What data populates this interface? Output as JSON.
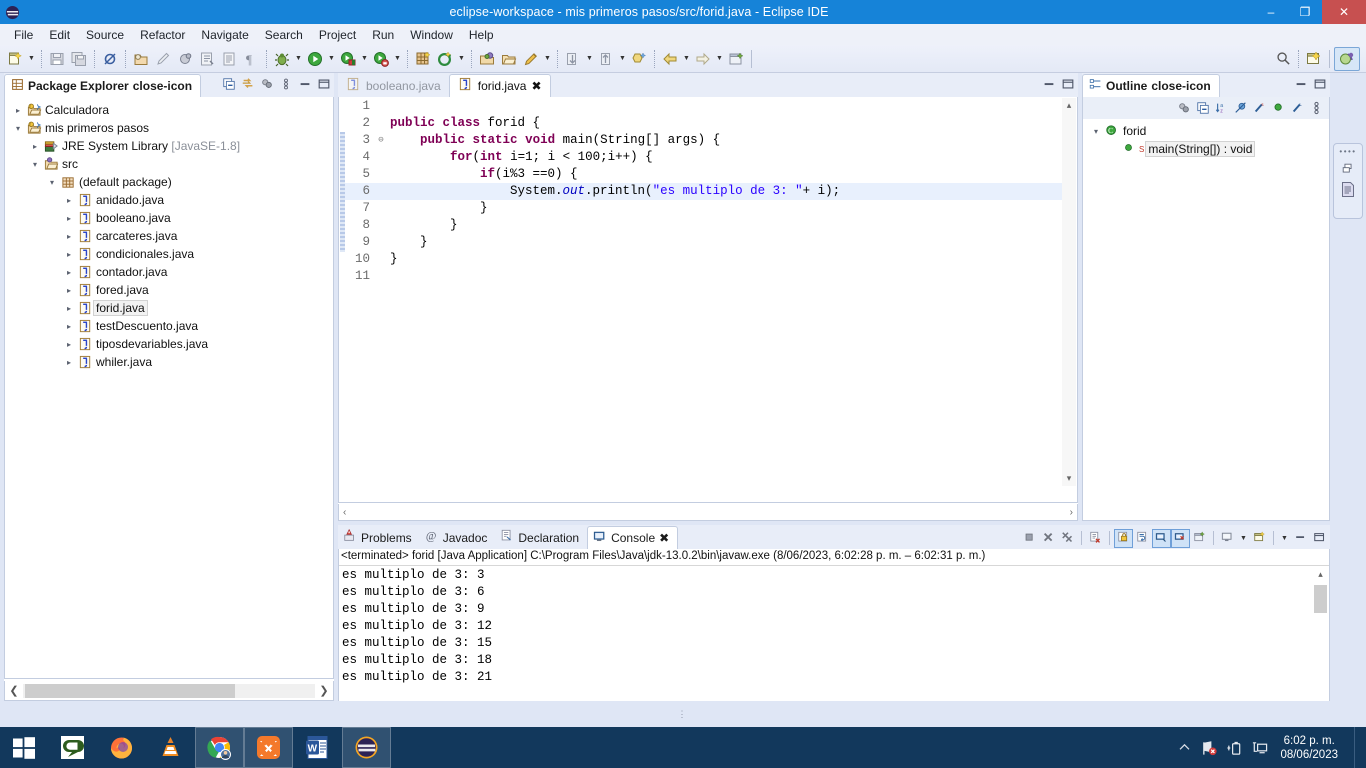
{
  "window": {
    "title": "eclipse-workspace - mis primeros pasos/src/forid.java - Eclipse IDE",
    "logo_icon": "eclipse-logo-icon",
    "minimize_label": "–",
    "maximize_label": "❐",
    "close_label": "✕",
    "accent_color": "#1683d8",
    "close_color": "#c75050"
  },
  "menubar": {
    "items": [
      {
        "label": "File"
      },
      {
        "label": "Edit"
      },
      {
        "label": "Source"
      },
      {
        "label": "Refactor"
      },
      {
        "label": "Navigate"
      },
      {
        "label": "Search"
      },
      {
        "label": "Project"
      },
      {
        "label": "Run"
      },
      {
        "label": "Window"
      },
      {
        "label": "Help"
      }
    ]
  },
  "toolbar": {
    "buttons": [
      {
        "name": "new-wizard",
        "icon": "new-file-icon",
        "has_arrow": true
      },
      {
        "name": "save",
        "icon": "save-icon",
        "has_arrow": false
      },
      {
        "name": "save-all",
        "icon": "save-all-icon",
        "has_arrow": false
      },
      {
        "name": "toggle-breakpoint",
        "icon": "breakpoint-disabled-icon",
        "has_arrow": false
      },
      {
        "name": "new-java-project",
        "icon": "java-project-icon",
        "has_arrow": false
      },
      {
        "name": "new-package",
        "icon": "pencil-icon",
        "has_arrow": false
      },
      {
        "name": "new-class",
        "icon": "class-icon",
        "has_arrow": false
      },
      {
        "name": "open-task",
        "icon": "task-icon",
        "has_arrow": false
      },
      {
        "name": "toggle-mark-occurrences",
        "icon": "document-icon",
        "has_arrow": false
      },
      {
        "name": "show-whitespace",
        "icon": "pilcrow-icon",
        "has_arrow": false
      },
      {
        "name": "debug",
        "icon": "bug-icon",
        "has_arrow": true
      },
      {
        "name": "run",
        "icon": "run-green-icon",
        "has_arrow": true
      },
      {
        "name": "run-coverage",
        "icon": "coverage-icon",
        "has_arrow": true
      },
      {
        "name": "external-tools",
        "icon": "external-tools-icon",
        "has_arrow": true
      },
      {
        "name": "new-junit-test",
        "icon": "junit-icon",
        "has_arrow": false
      },
      {
        "name": "new-annotation",
        "icon": "refresh-green-icon",
        "has_arrow": true
      },
      {
        "name": "open-type",
        "icon": "open-type-icon",
        "has_arrow": false
      },
      {
        "name": "open-resource",
        "icon": "open-folder-icon",
        "has_arrow": false
      },
      {
        "name": "quick-fix",
        "icon": "pen-icon",
        "has_arrow": true
      },
      {
        "name": "next-annotation",
        "icon": "next-annotation-icon",
        "has_arrow": true
      },
      {
        "name": "previous-annotation",
        "icon": "prev-annotation-icon",
        "has_arrow": true
      },
      {
        "name": "last-edit-location",
        "icon": "last-edit-icon",
        "has_arrow": false
      },
      {
        "name": "back",
        "icon": "back-arrow-icon",
        "has_arrow": true
      },
      {
        "name": "forward",
        "icon": "forward-arrow-icon",
        "has_arrow": true
      },
      {
        "name": "pin-editor",
        "icon": "pin-editor-icon",
        "has_arrow": false
      }
    ],
    "right": {
      "search_icon": "search-icon",
      "new-perspective_icon": "open-perspective-icon",
      "java_perspective_icon": "java-perspective-icon"
    }
  },
  "package_explorer": {
    "title": "Package Explorer",
    "close_icon": "close-icon",
    "tools": [
      {
        "name": "collapse-all",
        "icon": "collapse-all-icon"
      },
      {
        "name": "link-with-editor",
        "icon": "link-editor-icon"
      },
      {
        "name": "view-filter",
        "icon": "filter-icon"
      },
      {
        "name": "view-menu",
        "icon": "view-menu-icon"
      },
      {
        "name": "minimize",
        "icon": "minimize-icon"
      },
      {
        "name": "maximize",
        "icon": "maximize-icon"
      }
    ],
    "tree": [
      {
        "label": "Calculadora",
        "icon": "java-project-icon",
        "depth": 0,
        "twisty": "collapsed",
        "selected": false
      },
      {
        "label": "mis primeros pasos",
        "icon": "java-project-icon",
        "depth": 0,
        "twisty": "expanded",
        "selected": false
      },
      {
        "label": "JRE System Library",
        "suffix": " [JavaSE-1.8]",
        "icon": "library-icon",
        "depth": 1,
        "twisty": "collapsed",
        "selected": false
      },
      {
        "label": "src",
        "icon": "source-folder-icon",
        "depth": 1,
        "twisty": "expanded",
        "selected": false
      },
      {
        "label": "(default package)",
        "icon": "package-icon",
        "depth": 2,
        "twisty": "expanded",
        "selected": false
      },
      {
        "label": "anidado.java",
        "icon": "java-file-icon",
        "depth": 3,
        "twisty": "collapsed",
        "selected": false
      },
      {
        "label": "booleano.java",
        "icon": "java-file-icon",
        "depth": 3,
        "twisty": "collapsed",
        "selected": false
      },
      {
        "label": "carcateres.java",
        "icon": "java-file-icon",
        "depth": 3,
        "twisty": "collapsed",
        "selected": false
      },
      {
        "label": "condicionales.java",
        "icon": "java-file-icon",
        "depth": 3,
        "twisty": "collapsed",
        "selected": false
      },
      {
        "label": "contador.java",
        "icon": "java-file-icon",
        "depth": 3,
        "twisty": "collapsed",
        "selected": false
      },
      {
        "label": "fored.java",
        "icon": "java-file-icon",
        "depth": 3,
        "twisty": "collapsed",
        "selected": false
      },
      {
        "label": "forid.java",
        "icon": "java-file-icon",
        "depth": 3,
        "twisty": "collapsed",
        "selected": true
      },
      {
        "label": "testDescuento.java",
        "icon": "java-file-icon",
        "depth": 3,
        "twisty": "collapsed",
        "selected": false
      },
      {
        "label": "tiposdevariables.java",
        "icon": "java-file-icon",
        "depth": 3,
        "twisty": "collapsed",
        "selected": false
      },
      {
        "label": "whiler.java",
        "icon": "java-file-icon",
        "depth": 3,
        "twisty": "collapsed",
        "selected": false
      }
    ]
  },
  "editor": {
    "tabs": [
      {
        "label": "booleano.java",
        "icon": "java-file-icon",
        "active": false,
        "closeable": false
      },
      {
        "label": "forid.java",
        "icon": "java-file-icon",
        "active": true,
        "closeable": true,
        "close_icon": "close-icon"
      }
    ],
    "tools": [
      {
        "name": "restore",
        "icon": "restore-icon"
      },
      {
        "name": "maximize",
        "icon": "maximize-icon"
      }
    ],
    "lines": [
      {
        "num": "1",
        "fold": "",
        "highlight": false,
        "tokens": []
      },
      {
        "num": "2",
        "fold": "",
        "highlight": false,
        "tokens": [
          {
            "t": "public",
            "c": "kw"
          },
          {
            "t": " ",
            "c": ""
          },
          {
            "t": "class",
            "c": "kw"
          },
          {
            "t": " forid {",
            "c": ""
          }
        ]
      },
      {
        "num": "3",
        "fold": "⊖",
        "highlight": false,
        "tokens": [
          {
            "t": "    ",
            "c": ""
          },
          {
            "t": "public",
            "c": "kw"
          },
          {
            "t": " ",
            "c": ""
          },
          {
            "t": "static",
            "c": "kw"
          },
          {
            "t": " ",
            "c": ""
          },
          {
            "t": "void",
            "c": "kw"
          },
          {
            "t": " main(String[] args) {",
            "c": ""
          }
        ]
      },
      {
        "num": "4",
        "fold": "",
        "highlight": false,
        "tokens": [
          {
            "t": "        ",
            "c": ""
          },
          {
            "t": "for",
            "c": "kw"
          },
          {
            "t": "(",
            "c": ""
          },
          {
            "t": "int",
            "c": "kw"
          },
          {
            "t": " i=1; i < 100;i++) {",
            "c": ""
          }
        ]
      },
      {
        "num": "5",
        "fold": "",
        "highlight": false,
        "tokens": [
          {
            "t": "            ",
            "c": ""
          },
          {
            "t": "if",
            "c": "kw"
          },
          {
            "t": "(i%3 ==0) {",
            "c": ""
          }
        ]
      },
      {
        "num": "6",
        "fold": "",
        "highlight": true,
        "tokens": [
          {
            "t": "                System.",
            "c": ""
          },
          {
            "t": "out",
            "c": "fld"
          },
          {
            "t": ".println(",
            "c": ""
          },
          {
            "t": "\"es multiplo de 3: \"",
            "c": "str"
          },
          {
            "t": "+ i);",
            "c": ""
          }
        ]
      },
      {
        "num": "7",
        "fold": "",
        "highlight": false,
        "tokens": [
          {
            "t": "            }",
            "c": ""
          }
        ]
      },
      {
        "num": "8",
        "fold": "",
        "highlight": false,
        "tokens": [
          {
            "t": "        }",
            "c": ""
          }
        ]
      },
      {
        "num": "9",
        "fold": "",
        "highlight": false,
        "tokens": [
          {
            "t": "    }",
            "c": ""
          }
        ]
      },
      {
        "num": "10",
        "fold": "",
        "highlight": false,
        "tokens": [
          {
            "t": "}",
            "c": ""
          }
        ]
      },
      {
        "num": "11",
        "fold": "",
        "highlight": false,
        "tokens": []
      }
    ],
    "scroll_up_icon": "▴",
    "scroll_down_icon": "▾",
    "hscroll_left_icon": "‹",
    "hscroll_right_icon": "›"
  },
  "outline": {
    "title": "Outline",
    "close_icon": "close-icon",
    "header_tools": [
      {
        "name": "minimize",
        "icon": "minimize-icon"
      },
      {
        "name": "maximize",
        "icon": "maximize-icon"
      }
    ],
    "toolbar": [
      {
        "name": "focus-on-active-task",
        "icon": "focus-task-icon"
      },
      {
        "name": "collapse-all",
        "icon": "collapse-all-icon"
      },
      {
        "name": "sort",
        "icon": "sort-az-icon"
      },
      {
        "name": "hide-fields",
        "icon": "hide-fields-icon"
      },
      {
        "name": "hide-static-members",
        "icon": "hide-static-icon"
      },
      {
        "name": "hide-non-public",
        "icon": "hide-nonpublic-icon"
      },
      {
        "name": "hide-local-types",
        "icon": "hide-local-types-icon"
      },
      {
        "name": "view-menu",
        "icon": "view-menu-icon"
      }
    ],
    "tree": [
      {
        "label": "forid",
        "icon": "class-outline-icon",
        "depth": 0,
        "twisty": "expanded",
        "selected": false
      },
      {
        "label": "main(String[]) : void",
        "icon": "method-public-static-icon",
        "depth": 1,
        "twisty": "none",
        "selected": true
      }
    ]
  },
  "fastview": {
    "items": [
      {
        "name": "restore-view",
        "icon": "restore-icon"
      },
      {
        "name": "task-list",
        "icon": "task-list-icon"
      }
    ]
  },
  "console_panel": {
    "tabs": [
      {
        "label": "Problems",
        "icon": "problems-icon",
        "active": false
      },
      {
        "label": "Javadoc",
        "icon": "javadoc-at-icon",
        "active": false
      },
      {
        "label": "Declaration",
        "icon": "declaration-icon",
        "active": false
      },
      {
        "label": "Console",
        "icon": "console-icon",
        "active": true,
        "close_icon": "close-icon"
      }
    ],
    "tools": [
      {
        "name": "terminate",
        "icon": "terminate-icon",
        "toggled": false
      },
      {
        "name": "remove-launch",
        "icon": "remove-icon",
        "toggled": false
      },
      {
        "name": "remove-all-terminated",
        "icon": "remove-all-icon",
        "toggled": false
      },
      {
        "name": "clear-console",
        "icon": "clear-console-icon",
        "toggled": false
      },
      {
        "name": "scroll-lock",
        "icon": "scroll-lock-icon",
        "toggled": true
      },
      {
        "name": "word-wrap",
        "icon": "word-wrap-icon",
        "toggled": false
      },
      {
        "name": "show-console-on-output",
        "icon": "show-on-output-icon",
        "toggled": true
      },
      {
        "name": "show-console-on-error",
        "icon": "show-on-error-icon",
        "toggled": true
      },
      {
        "name": "pin-console",
        "icon": "pin-console-icon",
        "toggled": false
      },
      {
        "name": "display-selected-console",
        "icon": "display-console-icon",
        "toggled": false
      },
      {
        "name": "open-console",
        "icon": "open-console-icon",
        "toggled": false
      },
      {
        "name": "minimize",
        "icon": "minimize-icon",
        "toggled": false
      },
      {
        "name": "maximize",
        "icon": "maximize-icon",
        "toggled": false
      }
    ],
    "status_line": "<terminated> forid [Java Application] C:\\Program Files\\Java\\jdk-13.0.2\\bin\\javaw.exe  (8/06/2023, 6:02:28 p. m. – 6:02:31 p. m.)",
    "output": [
      "es multiplo de 3: 3",
      "es multiplo de 3: 6",
      "es multiplo de 3: 9",
      "es multiplo de 3: 12",
      "es multiplo de 3: 15",
      "es multiplo de 3: 18",
      "es multiplo de 3: 21"
    ],
    "scroll_up_icon": "▴",
    "scroll_down_icon": "▾",
    "hscroll_left_icon": "‹"
  },
  "status_drag": "⋮",
  "taskbar": {
    "start_icon": "windows-start-icon",
    "apps": [
      {
        "name": "camtasia",
        "icon": "camtasia-icon",
        "running": false
      },
      {
        "name": "firefox",
        "icon": "firefox-icon",
        "running": false
      },
      {
        "name": "vlc",
        "icon": "vlc-icon",
        "running": false
      },
      {
        "name": "chrome",
        "icon": "chrome-icon",
        "running": true
      },
      {
        "name": "xampp",
        "icon": "xampp-icon",
        "running": true
      },
      {
        "name": "word",
        "icon": "word-icon",
        "running": false
      },
      {
        "name": "eclipse",
        "icon": "eclipse-icon",
        "running": true
      }
    ],
    "tray": [
      {
        "name": "show-hidden-icons",
        "icon": "chevron-up-icon"
      },
      {
        "name": "network-error",
        "icon": "network-error-icon"
      },
      {
        "name": "battery",
        "icon": "battery-icon"
      },
      {
        "name": "display",
        "icon": "display-icon"
      }
    ],
    "clock_time": "6:02 p. m.",
    "clock_date": "08/06/2023"
  }
}
